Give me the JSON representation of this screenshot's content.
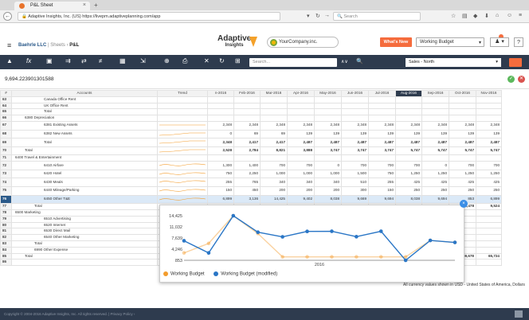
{
  "browser": {
    "tab_title": "P&L Sheet",
    "url_prefix": "Adaptive Insights, Inc. (US)",
    "url": "https://livepm.adaptiveplanning.com/app",
    "search_placeholder": "Search"
  },
  "app": {
    "breadcrumb": {
      "org": "Baehrle LLC",
      "sheets": "Sheets",
      "page": "P&L"
    },
    "logo_main": "Adaptive",
    "logo_sub": "Insights",
    "company": "YourCompany.inc.",
    "whats_new": "What's New",
    "version": "Working Budget"
  },
  "toolbar": {
    "search_placeholder": "Search...",
    "level": "Sales - North"
  },
  "formula": {
    "value": "9,694.223901301588"
  },
  "grid": {
    "headers": [
      "#",
      "Accounts",
      "Trend",
      "n-2016",
      "Feb-2016",
      "Mar-2016",
      "Apr-2016",
      "May-2016",
      "Jun-2016",
      "Jul-2016",
      "Aug-2016",
      "Sep-2016",
      "Oct-2016",
      "Nov-2016"
    ],
    "rows": [
      {
        "num": "63",
        "name": "Canada Office Rent",
        "v": [
          "",
          "",
          "",
          "",
          "",
          "",
          "",
          "",
          "",
          "",
          ""
        ]
      },
      {
        "num": "64",
        "name": "UK Office Rent",
        "v": [
          "",
          "",
          "",
          "",
          "",
          "",
          "",
          "",
          "",
          "",
          ""
        ]
      },
      {
        "num": "65",
        "name": "Total",
        "v": [
          "",
          "",
          "",
          "",
          "",
          "",
          "",
          "",
          "",
          "",
          ""
        ]
      },
      {
        "num": "66",
        "name": "6380 Depreciation",
        "v": [
          "",
          "",
          "",
          "",
          "",
          "",
          "",
          "",
          "",
          "",
          ""
        ]
      },
      {
        "num": "67",
        "name": "6381 Existing Assets",
        "v": [
          "2,348",
          "2,348",
          "2,348",
          "2,348",
          "2,348",
          "2,348",
          "2,348",
          "2,348",
          "2,348",
          "2,348",
          "2,348"
        ]
      },
      {
        "num": "68",
        "name": "6382 New Assets",
        "v": [
          "0",
          "69",
          "69",
          "139",
          "139",
          "139",
          "139",
          "139",
          "139",
          "139",
          "139"
        ]
      },
      {
        "num": "69",
        "name": "Total",
        "v": [
          "2,348",
          "2,417",
          "2,417",
          "2,487",
          "2,487",
          "2,487",
          "2,487",
          "2,487",
          "2,487",
          "2,487",
          "2,487"
        ]
      },
      {
        "num": "70",
        "name": "Total",
        "v": [
          "2,528",
          "2,784",
          "8,821",
          "3,888",
          "3,747",
          "3,747",
          "3,747",
          "5,747",
          "5,747",
          "5,747",
          "5,747"
        ]
      },
      {
        "num": "71",
        "name": "6400 Travel & Entertainment",
        "v": [
          "",
          "",
          "",
          "",
          "",
          "",
          "",
          "",
          "",
          "",
          ""
        ]
      },
      {
        "num": "72",
        "name": "6410 Airfare",
        "v": [
          "1,300",
          "1,400",
          "700",
          "700",
          "0",
          "700",
          "700",
          "700",
          "0",
          "700",
          "700"
        ]
      },
      {
        "num": "73",
        "name": "6420 Hotel",
        "v": [
          "750",
          "2,250",
          "1,000",
          "1,000",
          "1,000",
          "1,500",
          "750",
          "1,250",
          "1,250",
          "1,250",
          "1,250"
        ]
      },
      {
        "num": "74",
        "name": "6430 Meals",
        "v": [
          "255",
          "765",
          "340",
          "340",
          "340",
          "510",
          "255",
          "425",
          "425",
          "425",
          "425"
        ]
      },
      {
        "num": "75",
        "name": "6440 Mileage/Parking",
        "v": [
          "150",
          "450",
          "200",
          "200",
          "200",
          "300",
          "150",
          "250",
          "250",
          "250",
          "250"
        ]
      },
      {
        "num": "76",
        "name": "6450 Other T&E",
        "v": [
          "6,899",
          "3,136",
          "14,425",
          "9,402",
          "8,038",
          "9,669",
          "9,694",
          "8,038",
          "9,694",
          "853",
          "6,899"
        ]
      },
      {
        "num": "77",
        "name": "Total",
        "v": [
          "",
          "",
          "",
          "",
          "",
          "",
          "",
          "",
          "",
          "3,478",
          "9,524"
        ]
      },
      {
        "num": "78",
        "name": "6500 Marketing",
        "v": [
          "",
          "",
          "",
          "",
          "",
          "",
          "",
          "",
          "",
          "",
          ""
        ]
      },
      {
        "num": "79",
        "name": "6510 Advertising",
        "v": [
          "",
          "",
          "",
          "",
          "",
          "",
          "",
          "",
          "",
          "",
          ""
        ]
      },
      {
        "num": "80",
        "name": "6520 Internet",
        "v": [
          "",
          "",
          "",
          "",
          "",
          "",
          "",
          "",
          "",
          "",
          ""
        ]
      },
      {
        "num": "81",
        "name": "6530 Direct Mail",
        "v": [
          "",
          "",
          "",
          "",
          "",
          "",
          "",
          "",
          "",
          "",
          ""
        ]
      },
      {
        "num": "82",
        "name": "6540 Other Marketing",
        "v": [
          "",
          "",
          "",
          "",
          "",
          "",
          "",
          "",
          "",
          "",
          ""
        ]
      },
      {
        "num": "83",
        "name": "Total",
        "v": [
          "",
          "",
          "",
          "",
          "",
          "",
          "",
          "",
          "",
          "",
          ""
        ]
      },
      {
        "num": "84",
        "name": "6990 Other Expense",
        "v": [
          "",
          "",
          "",
          "",
          "",
          "",
          "",
          "",
          "",
          "",
          ""
        ]
      },
      {
        "num": "85",
        "name": "Total",
        "v": [
          "",
          "",
          "",
          "",
          "",
          "",
          "",
          "",
          "",
          "59,678",
          "65,724"
        ]
      },
      {
        "num": "86",
        "name": "",
        "v": [
          "",
          "",
          "",
          "",
          "",
          "",
          "",
          "",
          "",
          "",
          ""
        ]
      }
    ]
  },
  "chart_data": {
    "type": "line",
    "title": "",
    "x_tick_label": "2016",
    "y_ticks": [
      "14,425",
      "11,032",
      "7,639",
      "4,246",
      "853"
    ],
    "ylim": [
      853,
      14425
    ],
    "series": [
      {
        "name": "Working Budget",
        "color": "#f39c2c",
        "values": [
          3100,
          6000,
          14425,
          9000,
          1900,
          1900,
          1900,
          1900,
          1900,
          1900,
          6900,
          6300
        ]
      },
      {
        "name": "Working Budget (modified)",
        "color": "#2a76c6",
        "values": [
          6800,
          3100,
          14425,
          9400,
          8000,
          9650,
          9690,
          8040,
          9690,
          853,
          6900,
          6300
        ]
      }
    ]
  },
  "chart_colors": {
    "accent": "#f56c3d",
    "header": "#2e3b4e"
  },
  "note": "All currency values shown in USD - United States of America, Dollars",
  "footer": "Copyright © 2004-2016 Adaptive Insights, Inc. All rights reserved. | Privacy Policy ›"
}
